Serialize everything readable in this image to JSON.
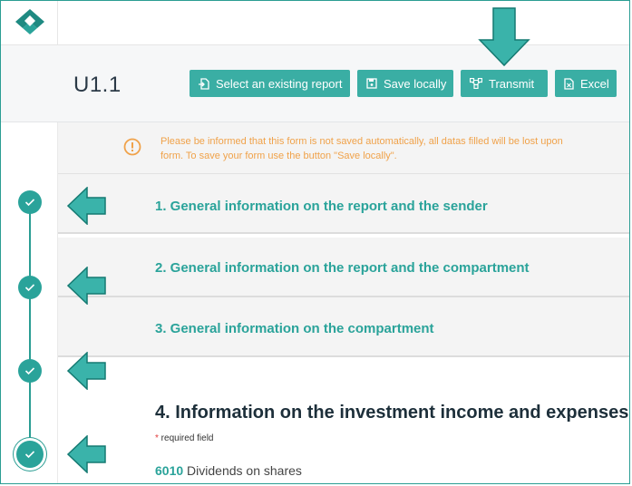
{
  "app": {
    "title": "U1.1"
  },
  "toolbar": {
    "select_report_label": "Select an existing report",
    "save_locally_label": "Save locally",
    "transmit_label": "Transmit",
    "excel_label": "Excel"
  },
  "notice": {
    "line1": "Please be informed that this form is not saved automatically, all datas filled will be lost upon",
    "line2": "form. To save your form use the button \"Save locally\"."
  },
  "sections": [
    {
      "title": "1. General information on the report and the sender"
    },
    {
      "title": "2. General information on the report and the compartment"
    },
    {
      "title": "3. General information on the compartment"
    }
  ],
  "main": {
    "title": "4. Information on the investment income and expenses",
    "required_star": "*",
    "required_label": " required field",
    "field_code": "6010",
    "field_label": " Dividends on shares"
  },
  "colors": {
    "accent": "#3aaea4",
    "warning": "#f0a24a",
    "step": "#2aa39a"
  }
}
